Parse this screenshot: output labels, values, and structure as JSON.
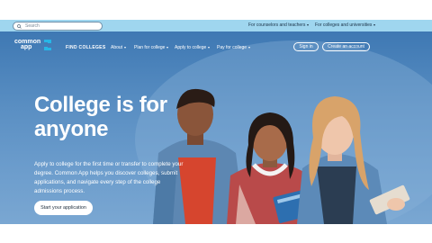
{
  "utility": {
    "search_placeholder": "Search",
    "links": [
      {
        "label": "For counselors and teachers"
      },
      {
        "label": "For colleges and universities"
      }
    ]
  },
  "nav": {
    "logo_line1": "common",
    "logo_line2": "app",
    "items": [
      {
        "label": "FIND COLLEGES"
      },
      {
        "label": "About"
      },
      {
        "label": "Plan for college"
      },
      {
        "label": "Apply to college"
      },
      {
        "label": "Pay for college"
      }
    ],
    "sign_in": "Sign in",
    "create_account": "Create an account"
  },
  "hero": {
    "headline_line1": "College is for",
    "headline_line2": "anyone",
    "blurb": "Apply to college for the first time or transfer to complete your degree. Common App helps you discover colleges, submit applications, and navigate every step of the college admissions process.",
    "cta": "Start your application"
  },
  "colors": {
    "utility_bar": "#9fd6ef",
    "hero_top": "#3e78b3",
    "hero_bottom": "#7aa7d2",
    "logo_accent": "#27b6e6"
  }
}
